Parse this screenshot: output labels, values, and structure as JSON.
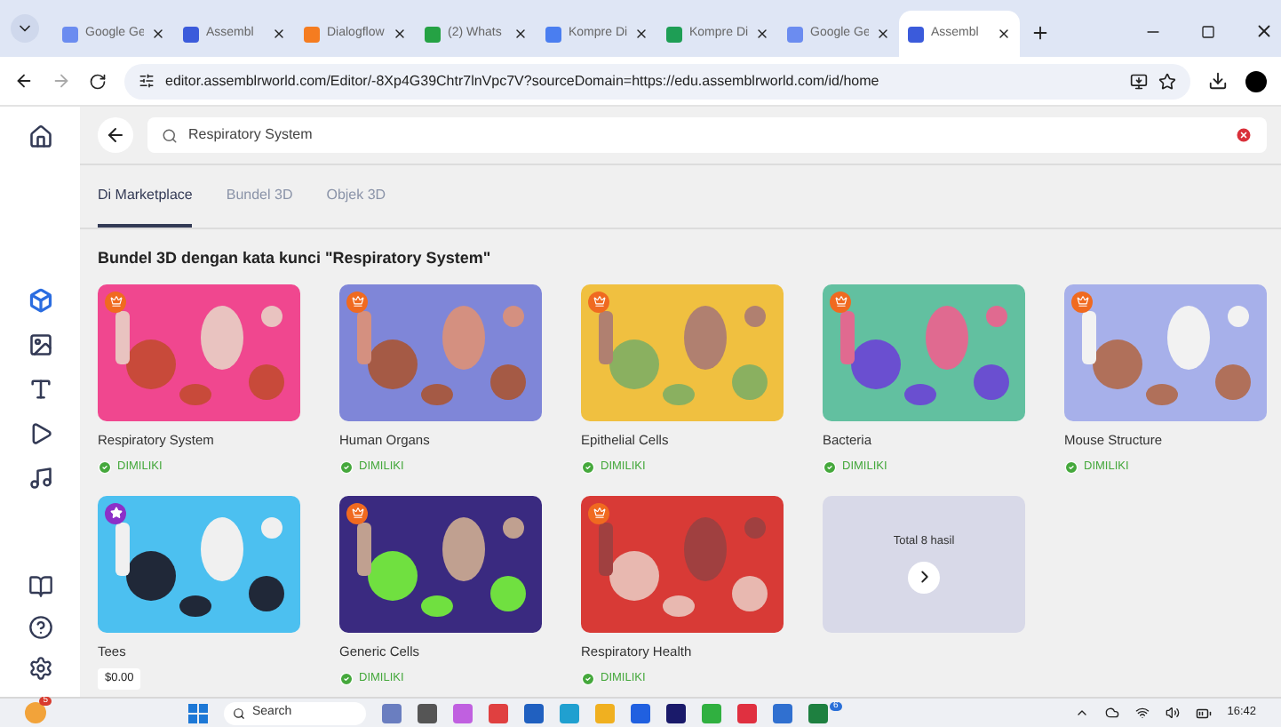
{
  "browser": {
    "tabs": [
      {
        "label": "Google Ge",
        "kind": "spark",
        "selected": false
      },
      {
        "label": "Assembl",
        "kind": "assemblr",
        "selected": false
      },
      {
        "label": "Dialogflow",
        "kind": "dialogflow",
        "selected": false
      },
      {
        "label": "(2) Whats",
        "kind": "chat",
        "selected": false
      },
      {
        "label": "Kompre Di",
        "kind": "doc",
        "selected": false
      },
      {
        "label": "Kompre Di",
        "kind": "sheet",
        "selected": false
      },
      {
        "label": "Google Ge",
        "kind": "spark",
        "selected": false
      },
      {
        "label": "Assembl",
        "kind": "assemblr",
        "selected": true
      }
    ],
    "url": "editor.assemblrworld.com/Editor/-8Xp4G39Chtr7lnVpc7V?sourceDomain=https://edu.assemblrworld.com/id/home"
  },
  "sidebar": {
    "items": [
      {
        "selected": false
      },
      {
        "selected": true
      },
      {
        "selected": false
      },
      {
        "selected": false
      },
      {
        "selected": false
      },
      {
        "selected": false
      }
    ]
  },
  "search": {
    "value": "Respiratory System"
  },
  "tabs": [
    {
      "label": "Di Marketplace",
      "selected": true
    },
    {
      "label": "Bundel 3D",
      "selected": false
    },
    {
      "label": "Objek 3D",
      "selected": false
    }
  ],
  "heading": "Bundel 3D dengan kata kunci \"Respiratory System\"",
  "results": [
    {
      "title": "Respiratory System",
      "kind": "crown",
      "owned": true,
      "status": "DIMILIKI"
    },
    {
      "title": "Human Organs",
      "kind": "crown",
      "owned": true,
      "status": "DIMILIKI"
    },
    {
      "title": "Epithelial Cells",
      "kind": "crown",
      "owned": true,
      "status": "DIMILIKI"
    },
    {
      "title": "Bacteria",
      "kind": "crown",
      "owned": true,
      "status": "DIMILIKI"
    },
    {
      "title": "Mouse Structure",
      "kind": "crown",
      "owned": true,
      "status": "DIMILIKI"
    },
    {
      "title": "Tees",
      "kind": "star",
      "owned": false,
      "status": "$0.00"
    },
    {
      "title": "Generic Cells",
      "kind": "crown",
      "owned": true,
      "status": "DIMILIKI"
    },
    {
      "title": "Respiratory Health",
      "kind": "crown",
      "owned": true,
      "status": "DIMILIKI"
    }
  ],
  "more": {
    "label": "Total 8 hasil"
  },
  "taskbar": {
    "weather_badge": "5",
    "search": {
      "placeholder": "Search"
    },
    "chat_badge": "6",
    "time": "16:42"
  }
}
